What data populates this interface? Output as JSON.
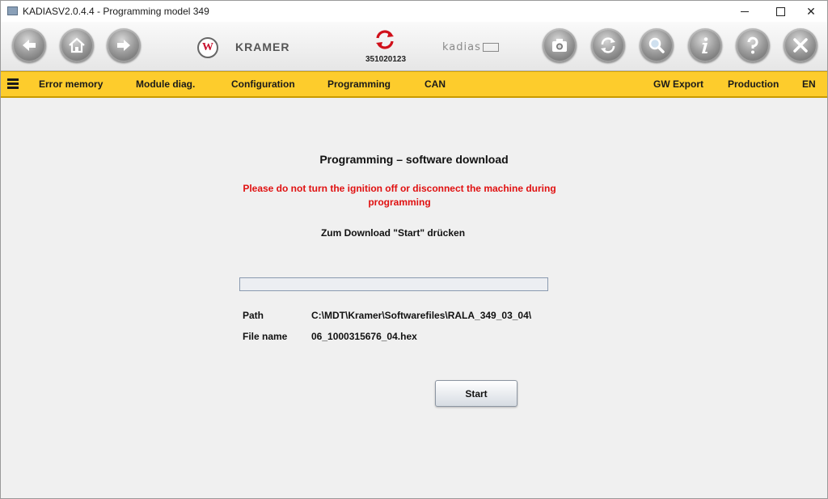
{
  "window": {
    "title": "KADIASV2.0.4.4 - Programming model 349"
  },
  "toolbar": {
    "buttons": [
      "back-icon",
      "home-icon",
      "forward-icon",
      "camera-icon",
      "refresh-icon",
      "search-icon",
      "info-icon",
      "help-icon",
      "close-icon"
    ],
    "brand_logo_letter": "W",
    "brand_name": "KRAMER",
    "serial": "351020123",
    "kadias_logo": "kadias"
  },
  "menu": {
    "items_left": [
      "Error memory",
      "Module diag.",
      "Configuration",
      "Programming",
      "CAN"
    ],
    "items_right": [
      "GW Export",
      "Production",
      "EN"
    ]
  },
  "content": {
    "heading": "Programming – software download",
    "warning": "Please do not turn the ignition off or disconnect the machine during programming",
    "instruction": "Zum Download \"Start\" drücken",
    "progress": 0,
    "path_label": "Path",
    "path_value": "C:\\MDT\\Kramer\\Softwarefiles\\RALA_349_03_04\\",
    "filename_label": "File name",
    "filename_value": "06_1000315676_04.hex",
    "start_label": "Start"
  },
  "colors": {
    "menu_bar": "#fdcc2c",
    "warning_text": "#e01010",
    "sync_icon": "#d0101a"
  }
}
